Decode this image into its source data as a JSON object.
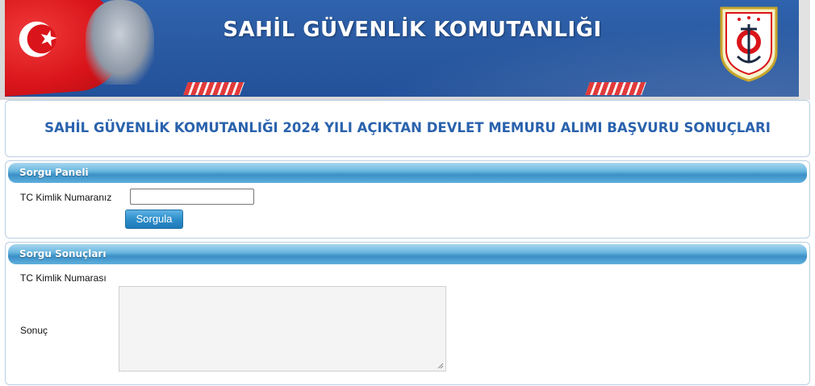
{
  "header": {
    "banner_title": "SAHİL GÜVENLİK KOMUTANLIĞI"
  },
  "page": {
    "title": "SAHİL GÜVENLİK KOMUTANLIĞI 2024 YILI AÇIKTAN DEVLET MEMURU ALIMI BAŞVURU SONUÇLARI"
  },
  "query_panel": {
    "header": "Sorgu Paneli",
    "tc_label": "TC Kimlik Numaranız",
    "tc_value": "",
    "button_label": "Sorgula"
  },
  "results_panel": {
    "header": "Sorgu Sonuçları",
    "tc_label": "TC Kimlik Numarası",
    "result_label": "Sonuç",
    "result_value": ""
  },
  "colors": {
    "banner_blue": "#2a5aa2",
    "title_blue": "#2a62ad",
    "panel_header_blue": "#3a8fc6",
    "flag_red": "#d9141a"
  },
  "icons": {
    "flag": "turkish-flag-icon",
    "portrait": "ataturk-portrait",
    "crest": "coast-guard-emblem"
  }
}
